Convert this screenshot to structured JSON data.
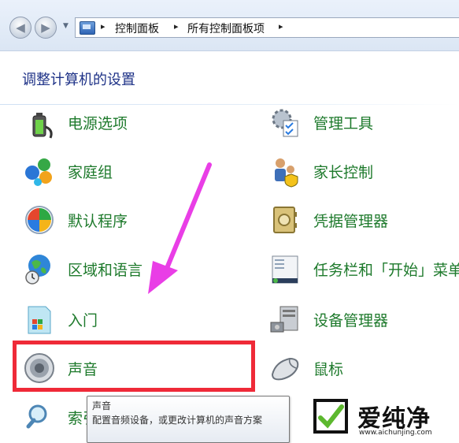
{
  "address_bar": {
    "back_arrow": "◀",
    "forward_arrow": "▶",
    "dropdown_arrow": "▼",
    "separator": "▸",
    "breadcrumbs": [
      "控制面板",
      "所有控制面板项"
    ]
  },
  "header": {
    "title": "调整计算机的设置"
  },
  "items_left": [
    {
      "label": "电源选项",
      "icon": "power-options-icon"
    },
    {
      "label": "家庭组",
      "icon": "homegroup-icon"
    },
    {
      "label": "默认程序",
      "icon": "default-programs-icon"
    },
    {
      "label": "区域和语言",
      "icon": "region-language-icon"
    },
    {
      "label": "入门",
      "icon": "getting-started-icon"
    },
    {
      "label": "声音",
      "icon": "sound-icon"
    },
    {
      "label": "索引",
      "icon": "indexing-icon"
    }
  ],
  "items_right": [
    {
      "label": "管理工具",
      "icon": "admin-tools-icon"
    },
    {
      "label": "家长控制",
      "icon": "parental-controls-icon"
    },
    {
      "label": "凭据管理器",
      "icon": "credential-manager-icon"
    },
    {
      "label": "任务栏和「开始」菜单",
      "icon": "taskbar-start-menu-icon"
    },
    {
      "label": "设备管理器",
      "icon": "device-manager-icon"
    },
    {
      "label": "鼠标",
      "icon": "mouse-icon"
    }
  ],
  "tooltip": {
    "title": "声音",
    "description": "配置音频设备，或更改计算机的声音方案"
  },
  "watermark": {
    "text": "爱纯净",
    "url": "www.aichunjing.com"
  },
  "colors": {
    "link_green": "#1e7a2c",
    "title_blue": "#1e3287",
    "highlight_red": "#ef2a38",
    "arrow_magenta": "#e93ee6"
  }
}
